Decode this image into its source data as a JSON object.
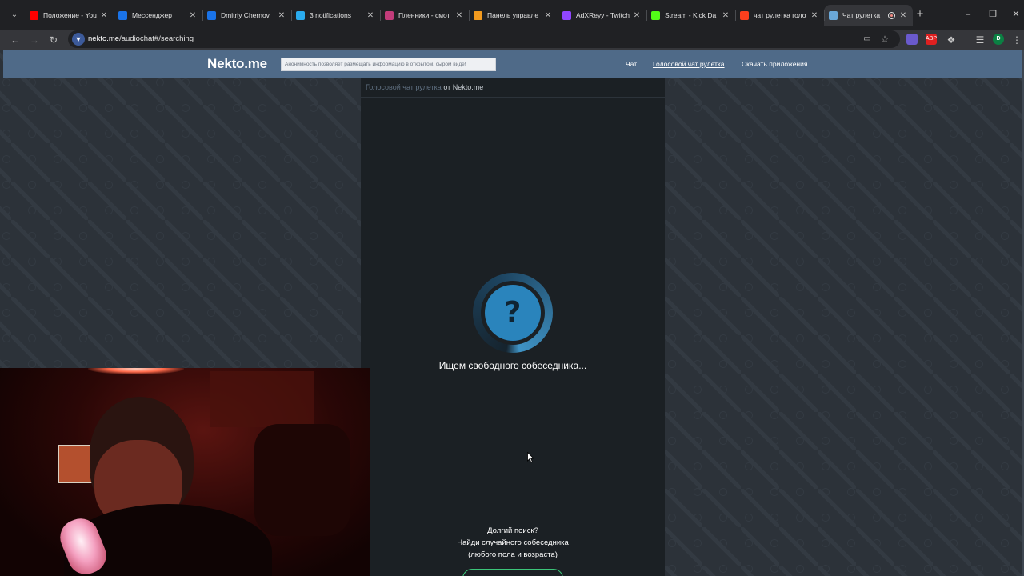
{
  "browser": {
    "tabs": [
      {
        "title": "Положение - You",
        "favicon_color": "#ff0000",
        "active": false
      },
      {
        "title": "Мессенджер",
        "favicon_color": "#1a73e8",
        "active": false
      },
      {
        "title": "Dmitriy Chernov",
        "favicon_color": "#1a73e8",
        "active": false
      },
      {
        "title": "3 notifications",
        "favicon_color": "#2aabee",
        "active": false
      },
      {
        "title": "Пленники - смот",
        "favicon_color": "#c23c7a",
        "active": false
      },
      {
        "title": "Панель управле",
        "favicon_color": "#f29a1e",
        "active": false
      },
      {
        "title": "AdXReyy - Twitch",
        "favicon_color": "#9146ff",
        "active": false
      },
      {
        "title": "Stream - Kick Da",
        "favicon_color": "#53fc18",
        "active": false
      },
      {
        "title": "чат рулетка голо",
        "favicon_color": "#fc3f1d",
        "active": false
      },
      {
        "title": "Чат рулетка",
        "favicon_color": "#6aa8d8",
        "active": true
      }
    ],
    "url_host": "nekto.me",
    "url_path": "/audiochat#/searching",
    "profile_initial": "D",
    "extension_badge": "ABP"
  },
  "site": {
    "logo": "Nekto.me",
    "notice": "Анонимность позволяет размещать информацию в открытом, сыром виде!",
    "nav": {
      "chat": "Чат",
      "voice": "Голосовой чат рулетка",
      "apps": "Скачать приложения"
    }
  },
  "main": {
    "breadcrumb_link": "Голосовой чат рулетка",
    "breadcrumb_text": " от Nekto.me",
    "search_icon_glyph": "?",
    "searching_text": "Ищем свободного собеседника...",
    "long_search_title": "Долгий поиск?",
    "long_search_line1": "Найди случайного собеседника",
    "long_search_line2": "(любого пола и возраста)"
  }
}
